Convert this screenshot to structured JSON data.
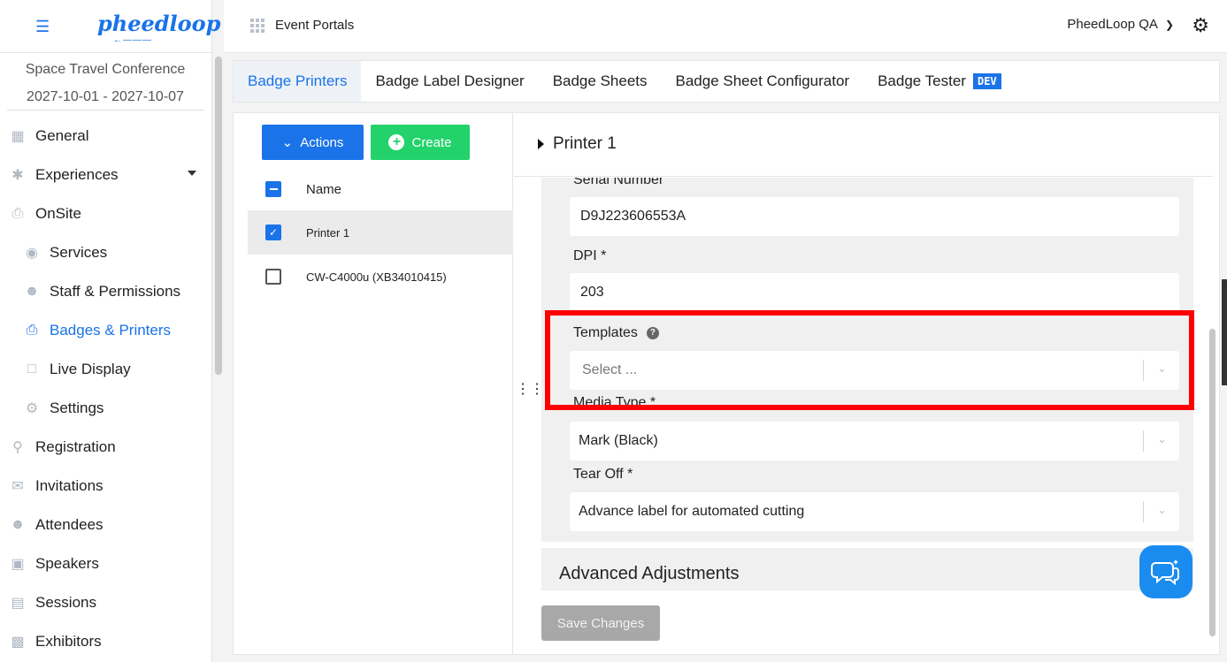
{
  "app": {
    "menu_icon": "hamburger-icon",
    "logo_text": "pheedloop",
    "logo_sub": "←———"
  },
  "event": {
    "name": "Space Travel Conference",
    "dates": "2027-10-01 - 2027-10-07"
  },
  "sidebar": {
    "items": [
      {
        "label": "General",
        "icon": "grid-icon"
      },
      {
        "label": "Experiences",
        "icon": "person-icon"
      },
      {
        "label": "OnSite",
        "icon": "printer-icon"
      },
      {
        "label": "Services",
        "icon": "palette-icon"
      },
      {
        "label": "Staff & Permissions",
        "icon": "people-icon"
      },
      {
        "label": "Badges & Printers",
        "icon": "printer-icon"
      },
      {
        "label": "Live Display",
        "icon": "monitor-icon"
      },
      {
        "label": "Settings",
        "icon": "gear-icon"
      },
      {
        "label": "Registration",
        "icon": "cart-icon"
      },
      {
        "label": "Invitations",
        "icon": "envelope-icon"
      },
      {
        "label": "Attendees",
        "icon": "people-icon"
      },
      {
        "label": "Speakers",
        "icon": "presenter-icon"
      },
      {
        "label": "Sessions",
        "icon": "laptop-icon"
      },
      {
        "label": "Exhibitors",
        "icon": "booth-icon"
      }
    ]
  },
  "topbar": {
    "portals_label": "Event Portals",
    "account_label": "PheedLoop QA"
  },
  "tabs": [
    {
      "label": "Badge Printers"
    },
    {
      "label": "Badge Label Designer"
    },
    {
      "label": "Badge Sheets"
    },
    {
      "label": "Badge Sheet Configurator"
    },
    {
      "label": "Badge Tester"
    }
  ],
  "dev_badge": "DEV",
  "list": {
    "actions_label": "Actions",
    "create_label": "Create",
    "header": "Name",
    "rows": [
      {
        "name": "Printer 1",
        "checked": true
      },
      {
        "name": "CW-C4000u (XB34010415)",
        "checked": false
      }
    ]
  },
  "detail": {
    "title": "Printer 1",
    "serial_label": "Serial Number",
    "serial_value": "D9J223606553A",
    "dpi_label": "DPI *",
    "dpi_value": "203",
    "templates_label": "Templates",
    "templates_placeholder": "Select ...",
    "media_label": "Media Type *",
    "media_value": "Mark (Black)",
    "tearoff_label": "Tear Off *",
    "tearoff_value": "Advance label for automated cutting",
    "advanced_title": "Advanced Adjustments",
    "save_label": "Save Changes"
  },
  "colors": {
    "accent": "#1a73e8",
    "create": "#23d26b",
    "highlight": "#ff0000"
  }
}
